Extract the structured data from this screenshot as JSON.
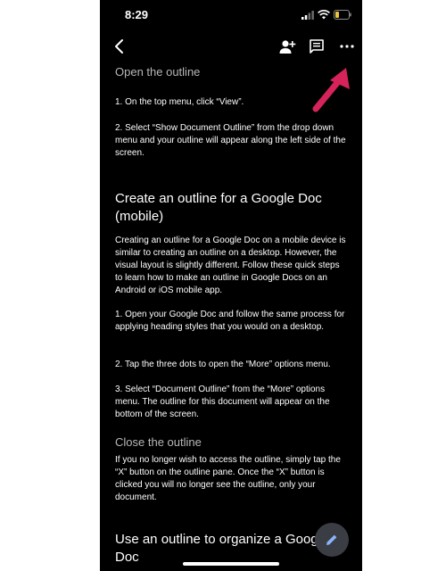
{
  "status_bar": {
    "time": "8:29"
  },
  "toolbar": {
    "icons": [
      "back-chevron-icon",
      "add-person-icon",
      "comment-icon",
      "more-dots-icon"
    ]
  },
  "document": {
    "sections": [
      {
        "heading": "Open the outline",
        "paragraphs": [
          "1. On the top menu, click “View”.",
          "2. Select “Show Document Outline” from the drop down menu and your outline will appear along the left side of the screen."
        ]
      },
      {
        "heading": "Create an outline for a Google Doc (mobile)",
        "paragraphs": [
          "Creating an outline for a Google Doc on a mobile device is similar to creating an outline on a desktop. However, the visual layout is slightly different. Follow these quick steps to learn how to make an outline in Google Docs on an Android or iOS mobile app.",
          "1. Open your Google Doc and follow the same process for applying heading styles that you would on a desktop.",
          "2. Tap the three dots to open the “More” options menu.",
          "3. Select “Document Outline” from the “More” options menu. The outline for this document will appear on the bottom of the screen."
        ]
      },
      {
        "heading": "Close the outline",
        "paragraphs": [
          "If you no longer wish to access the outline, simply tap the “X” button on the outline pane. Once the “X” button is clicked you will no longer see the outline, only your document."
        ]
      },
      {
        "heading": "Use an outline to organize a Google Doc",
        "paragraphs": []
      }
    ]
  },
  "colors": {
    "background": "#000000",
    "text": "#ffffff",
    "subheading": "#b7b7b7",
    "annotation_arrow": "#d6245b",
    "fab": "#3a3d44",
    "fab_icon": "#8ab4f8"
  }
}
